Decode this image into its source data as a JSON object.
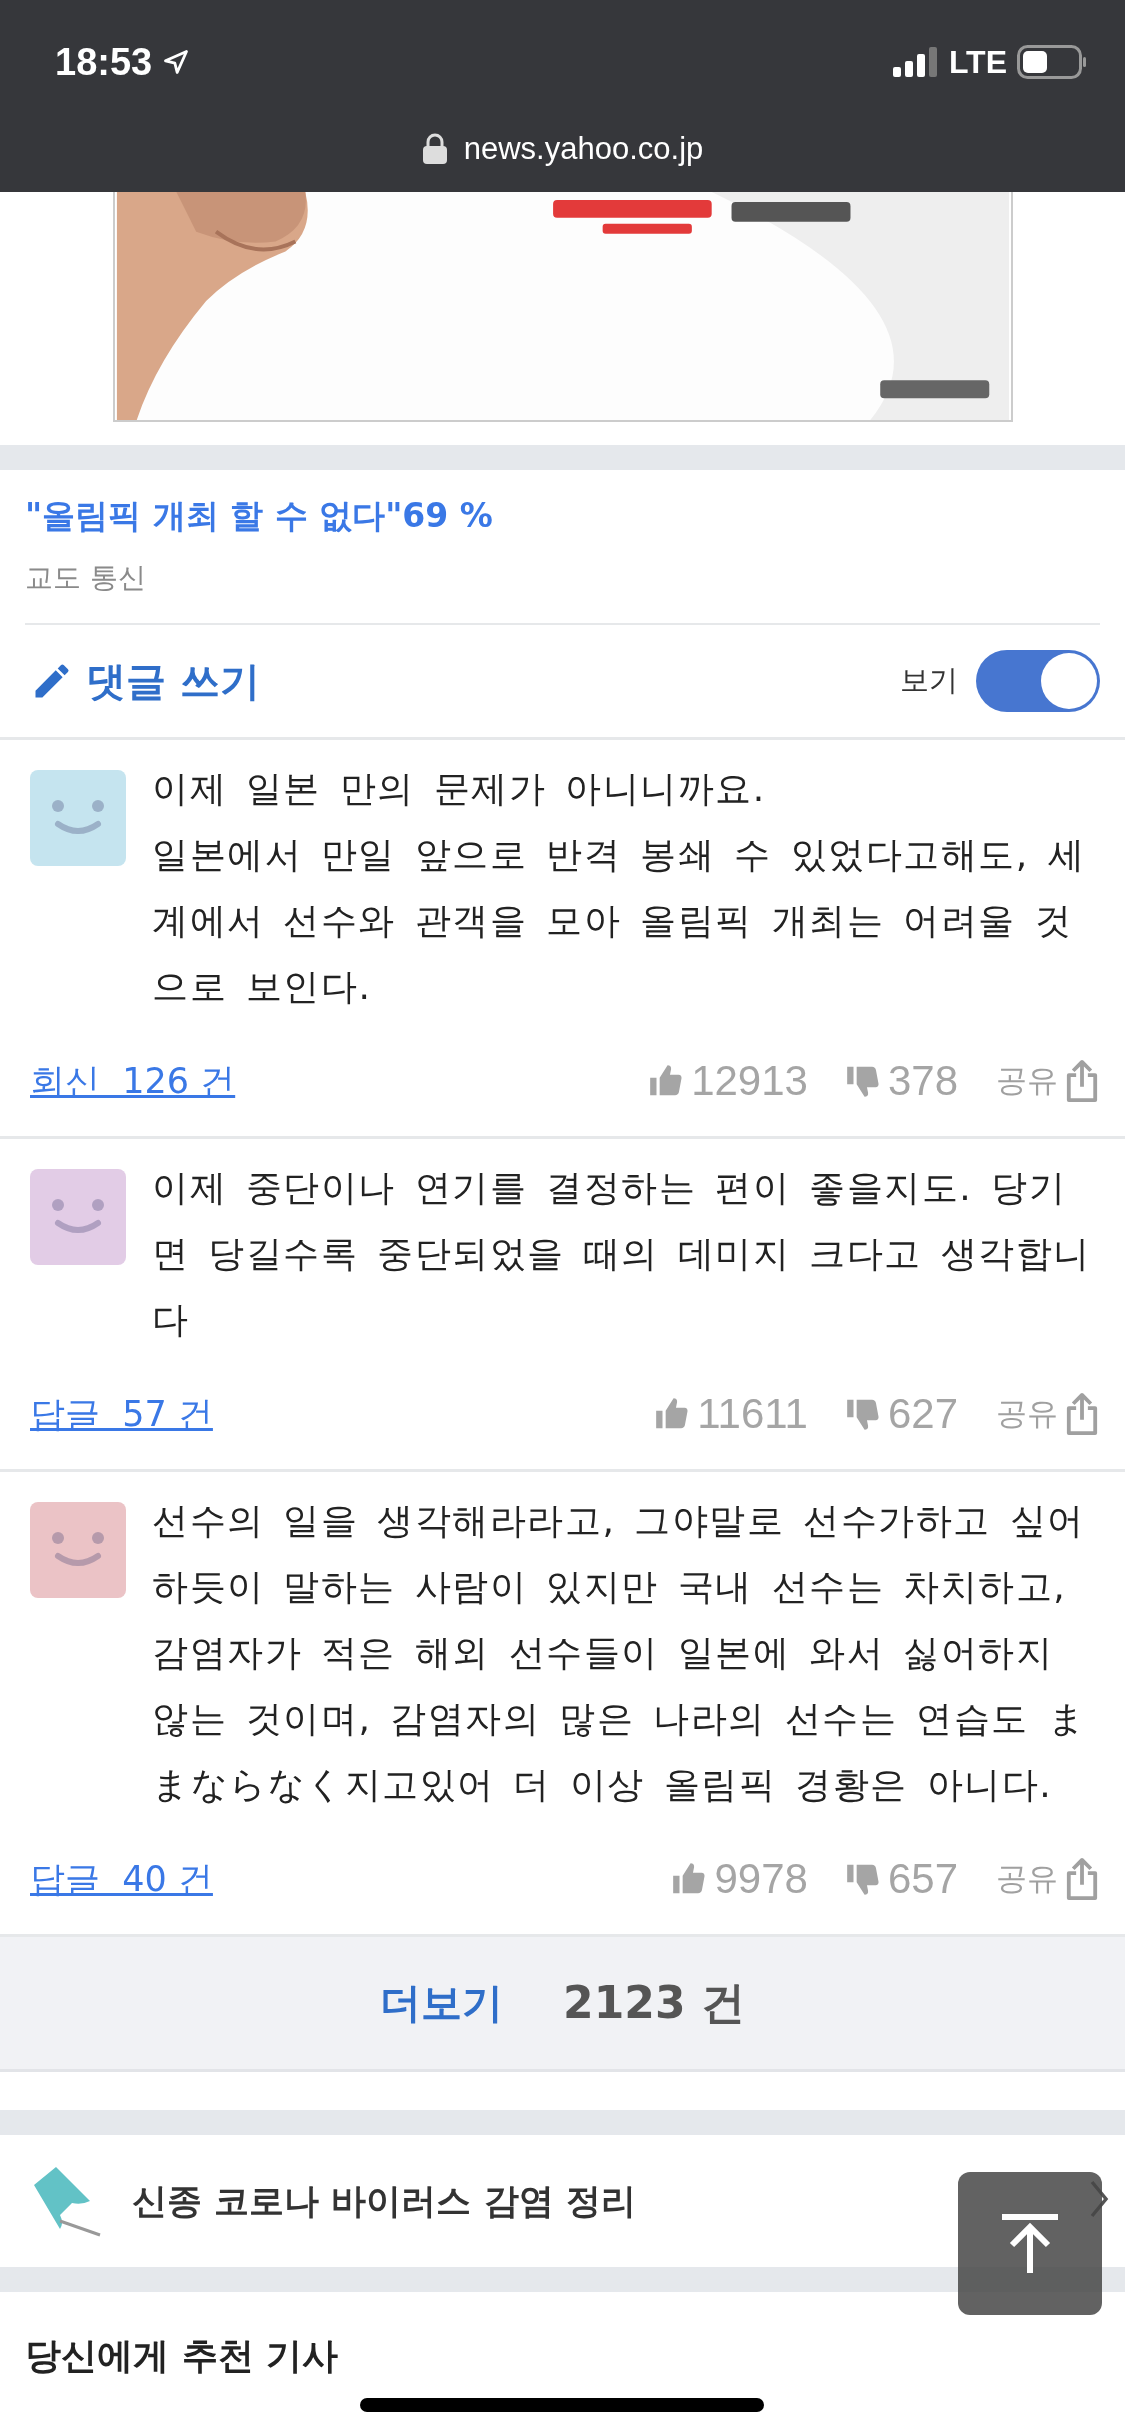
{
  "status_bar": {
    "time": "18:53",
    "network": "LTE"
  },
  "address_bar": {
    "url": "news.yahoo.co.jp"
  },
  "article": {
    "headline": "\"올림픽 개최 할 수 없다\"69 %",
    "source": "교도 통신"
  },
  "comments_header": {
    "write_label": "댓글 쓰기",
    "view_label": "보기",
    "view_on": true
  },
  "comments": [
    {
      "color": "#c5e4ef",
      "text": "이제 일본 만의 문제가 아니니까요.\n일본에서 만일 앞으로 반격 봉쇄 수 있었다고해도, 세계에서 선수와 관객을 모아 올림픽 개최는 어려울 것으로 보인다.",
      "reply_label": "회신  126 건",
      "likes": "12913",
      "dislikes": "378",
      "share_label": "공유"
    },
    {
      "color": "#e2cce6",
      "text": "이제 중단이나 연기를 결정하는 편이 좋을지도. 당기면 당길수록 중단되었을 때의 데미지 크다고 생각합니다",
      "reply_label": "답글  57 건",
      "likes": "11611",
      "dislikes": "627",
      "share_label": "공유"
    },
    {
      "color": "#ebc3c6",
      "text": "선수의 일을 생각해라라고, 그야말로 선수가하고 싶어하듯이 말하는 사람이 있지만 국내 선수는 차치하고, 감염자가 적은 해외 선수들이 일본에 와서 싫어하지 않는 것이며, 감염자의 많은 나라의 선수는 연습도 ままならなく지고있어 더 이상 올림픽 경황은 아니다.",
      "reply_label": "답글  40 건",
      "likes": "9978",
      "dislikes": "657",
      "share_label": "공유"
    }
  ],
  "more": {
    "label": "더보기",
    "count": "2123 건"
  },
  "topic_link": {
    "label": "신종 코로나 바이러스 감염 정리"
  },
  "recommended": {
    "title": "당신에게 추천 기사"
  }
}
